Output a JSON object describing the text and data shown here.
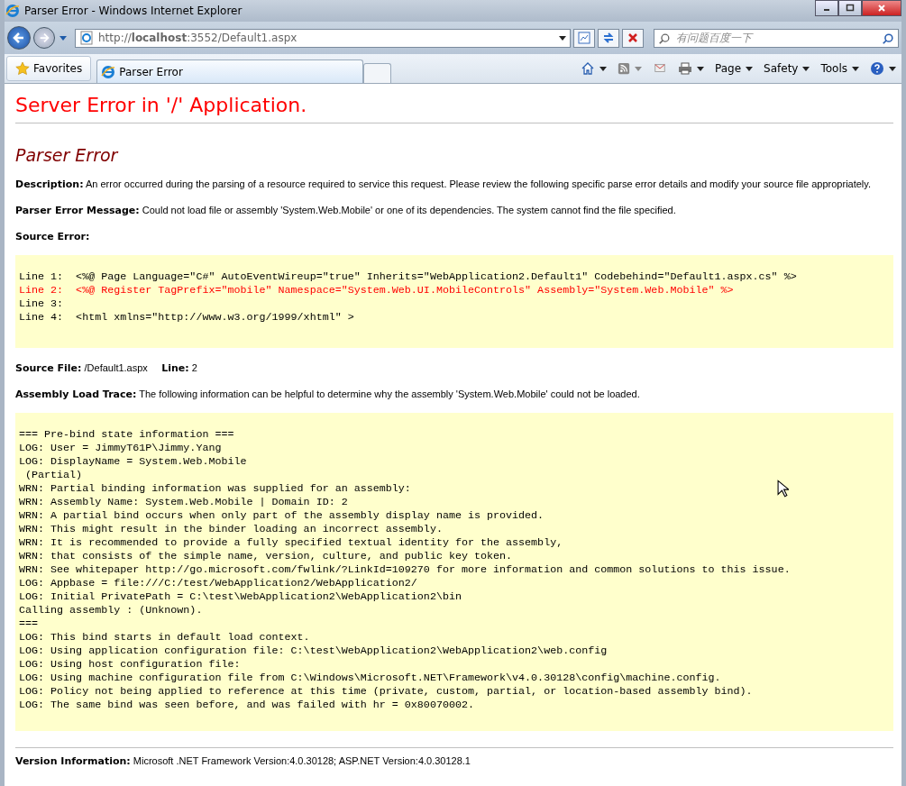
{
  "window": {
    "title": "Parser Error - Windows Internet Explorer"
  },
  "address_bar": {
    "url": "http://**localhost**:3552/Default1.aspx"
  },
  "search": {
    "placeholder": "有问题百度一下"
  },
  "favorites": {
    "label": "Favorites"
  },
  "tabs": [
    {
      "label": "Parser Error",
      "selected": true
    }
  ],
  "command_bar": [
    "Page",
    "Safety",
    "Tools"
  ],
  "page": {
    "heading": "Server Error in '/' Application.",
    "subheading": "Parser Error",
    "description": {
      "label": "Description:",
      "text": "An error occurred during the parsing of a resource required to service this request. Please review the following specific parse error details and modify your source file appropriately."
    },
    "parser_message": {
      "label": "Parser Error Message:",
      "text": "Could not load file or assembly 'System.Web.Mobile' or one of its dependencies. The system cannot find the file specified."
    },
    "source_error": {
      "label": "Source Error:",
      "lines": [
        {
          "text": "Line 1:  <%@ Page Language=\"C#\" AutoEventWireup=\"true\" Inherits=\"WebApplication2.Default1\" Codebehind=\"Default1.aspx.cs\" %>",
          "highlighted": false
        },
        {
          "text": "Line 2:  <%@ Register TagPrefix=\"mobile\" Namespace=\"System.Web.UI.MobileControls\" Assembly=\"System.Web.Mobile\" %>",
          "highlighted": true
        },
        {
          "text": "Line 3:",
          "highlighted": false
        },
        {
          "text": "Line 4:  <html xmlns=\"http://www.w3.org/1999/xhtml\" >",
          "highlighted": false
        }
      ]
    },
    "source_file": {
      "label": "Source File:",
      "value": "/Default1.aspx",
      "line_label": "Line:",
      "line_value": "2"
    },
    "assembly_trace": {
      "label": "Assembly Load Trace:",
      "text": "The following information can be helpful to determine why the assembly 'System.Web.Mobile' could not be loaded."
    },
    "trace_lines": [
      "=== Pre-bind state information ===",
      "LOG: User = JimmyT61P\\Jimmy.Yang",
      "LOG: DisplayName = System.Web.Mobile",
      " (Partial)",
      "WRN: Partial binding information was supplied for an assembly:",
      "WRN: Assembly Name: System.Web.Mobile | Domain ID: 2",
      "WRN: A partial bind occurs when only part of the assembly display name is provided.",
      "WRN: This might result in the binder loading an incorrect assembly.",
      "WRN: It is recommended to provide a fully specified textual identity for the assembly,",
      "WRN: that consists of the simple name, version, culture, and public key token.",
      "WRN: See whitepaper http://go.microsoft.com/fwlink/?LinkId=109270 for more information and common solutions to this issue.",
      "LOG: Appbase = file:///C:/test/WebApplication2/WebApplication2/",
      "LOG: Initial PrivatePath = C:\\test\\WebApplication2\\WebApplication2\\bin",
      "Calling assembly : (Unknown).",
      "===",
      "LOG: This bind starts in default load context.",
      "LOG: Using application configuration file: C:\\test\\WebApplication2\\WebApplication2\\web.config",
      "LOG: Using host configuration file:",
      "LOG: Using machine configuration file from C:\\Windows\\Microsoft.NET\\Framework\\v4.0.30128\\config\\machine.config.",
      "LOG: Policy not being applied to reference at this time (private, custom, partial, or location-based assembly bind).",
      "LOG: The same bind was seen before, and was failed with hr = 0x80070002."
    ],
    "version": {
      "label": "Version Information:",
      "text": "Microsoft .NET Framework Version:4.0.30128; ASP.NET Version:4.0.30128.1"
    }
  }
}
